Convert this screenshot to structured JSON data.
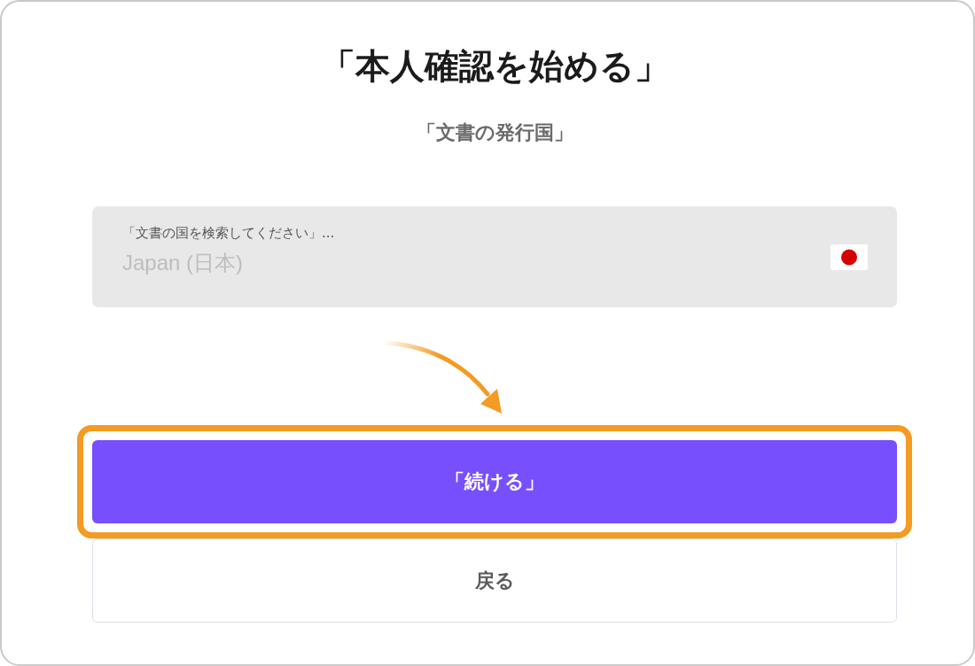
{
  "heading": {
    "title": "「本人確認を始める」",
    "subtitle": "「文書の発行国」"
  },
  "country_field": {
    "label": "「文書の国を検索してください」...",
    "value": "Japan (日本)"
  },
  "buttons": [
    {
      "label": "「続ける」",
      "kind": "primary",
      "highlighted": true
    },
    {
      "label": "戻る",
      "kind": "secondary",
      "highlighted": false
    }
  ]
}
